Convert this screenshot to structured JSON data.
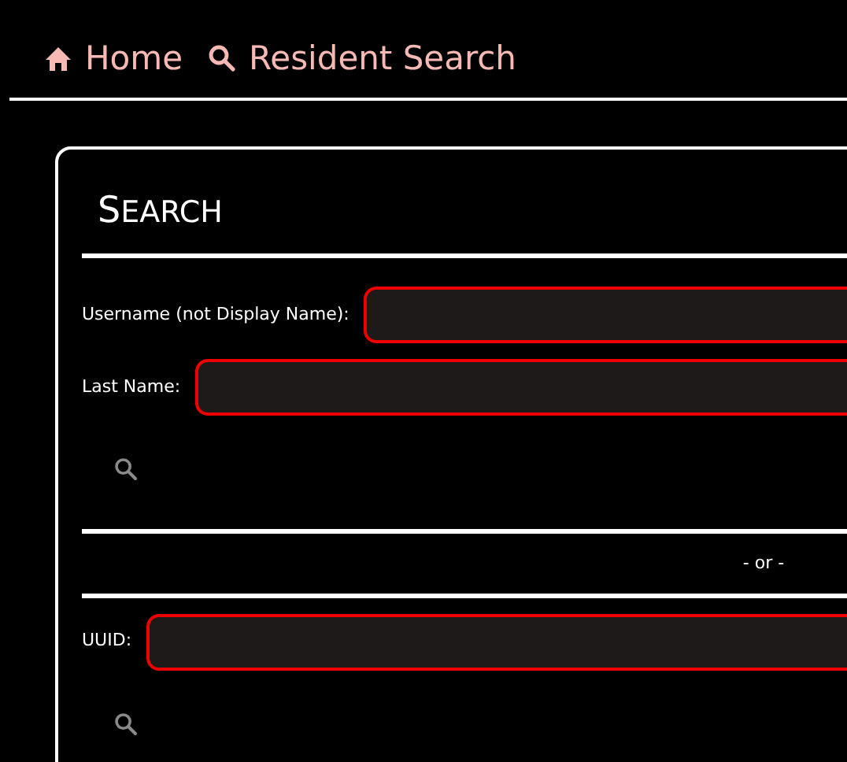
{
  "breadcrumb": [
    {
      "label": "Home",
      "kind": "home"
    },
    {
      "label": "Resident Search",
      "kind": "search"
    }
  ],
  "panel": {
    "title": "SEARCH",
    "groups": [
      {
        "fields": [
          {
            "label": "Username (not Display Name):"
          },
          {
            "label": "Last Name:"
          }
        ]
      },
      {
        "fields": [
          {
            "label": "UUID:"
          }
        ]
      }
    ],
    "separator": "- or -"
  }
}
